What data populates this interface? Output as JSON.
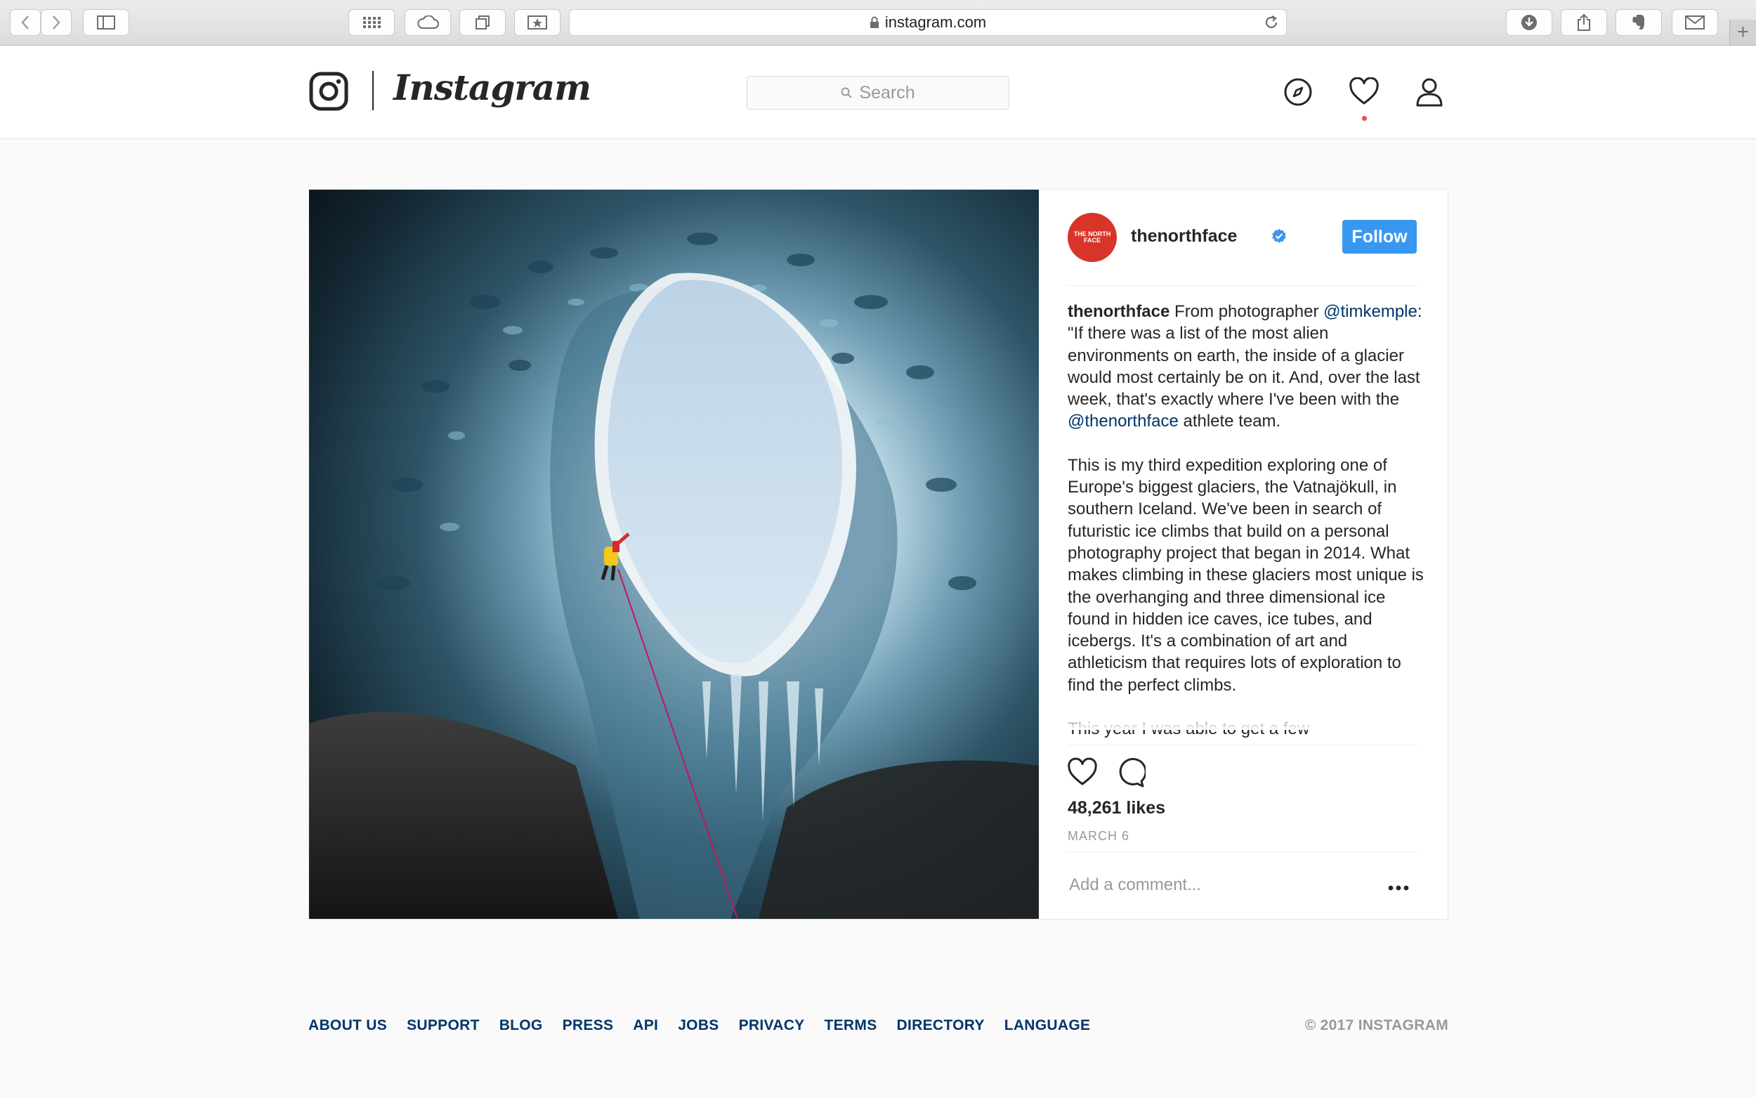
{
  "browser": {
    "url": "instagram.com"
  },
  "header": {
    "wordmark": "Instagram",
    "search_placeholder": "Search"
  },
  "post": {
    "username": "thenorthface",
    "avatar_text": "THE NORTH FACE",
    "follow_label": "Follow",
    "caption": {
      "author": "thenorthface",
      "p1_a": " From photographer ",
      "mention1": "@timkemple",
      "p1_b": ": \"If there was a list of the most alien environments on earth, the inside of a glacier would most certainly be on it. And, over the last week, that's exactly where I've been with the ",
      "mention2": "@thenorthface",
      "p1_c": " athlete team.",
      "p2": "This is my third expedition exploring one of Europe's biggest glaciers, the Vatnajökull, in southern Iceland. We've been in search of futuristic ice climbs that build on a personal photography project that began in 2014. What makes climbing in these glaciers most unique is the overhanging and three dimensional ice found in hidden ice caves, ice tubes, and icebergs. It's a combination of art and athleticism that requires lots of exploration to find the perfect climbs.",
      "p3": "This year I was able to get a few"
    },
    "likes": "48,261 likes",
    "date": "MARCH 6",
    "comment_placeholder": "Add a comment..."
  },
  "footer": {
    "links": [
      "ABOUT US",
      "SUPPORT",
      "BLOG",
      "PRESS",
      "API",
      "JOBS",
      "PRIVACY",
      "TERMS",
      "DIRECTORY",
      "LANGUAGE"
    ],
    "copyright": "© 2017 INSTAGRAM"
  },
  "colors": {
    "follow_blue": "#3897f0",
    "link_blue": "#003569",
    "notification_red": "#ed4956",
    "brand_red": "#d8352a"
  }
}
